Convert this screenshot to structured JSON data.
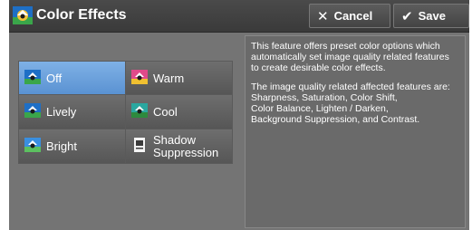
{
  "titlebar": {
    "title": "Color Effects",
    "title_icon": "color-effects-icon",
    "cancel_label": "Cancel",
    "cancel_icon": "close-icon",
    "save_label": "Save",
    "save_icon": "checkmark-icon"
  },
  "options": [
    {
      "label": "Off",
      "icon": "color-effects-icon",
      "selected": true
    },
    {
      "label": "Warm",
      "icon": "color-effects-icon",
      "selected": false
    },
    {
      "label": "Lively",
      "icon": "color-effects-icon",
      "selected": false
    },
    {
      "label": "Cool",
      "icon": "color-effects-icon",
      "selected": false
    },
    {
      "label": "Bright",
      "icon": "color-effects-icon",
      "selected": false
    },
    {
      "label": "Shadow Suppression",
      "icon": "shadow-suppression-icon",
      "selected": false
    }
  ],
  "description": {
    "paragraph1": "This feature offers preset color options which automatically set image quality related features to create desirable color effects.",
    "paragraph2": "The image quality related affected features are:\nSharpness, Saturation, Color Shift,\nColor Balance, Lighten / Darken,\nBackground Suppression, and Contrast."
  },
  "colors": {
    "selected": "#6fa3dd",
    "panel": "#747474",
    "titlebar": "#404040"
  }
}
